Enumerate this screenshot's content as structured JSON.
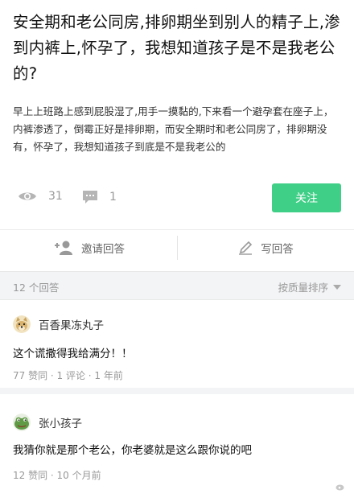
{
  "question": {
    "title": "安全期和老公同房,排卵期坐到别人的精子上,渗到内裤上,怀孕了，我想知道孩子是不是我老公的?",
    "body": "早上上班路上感到屁股湿了,用手一摸黏的,下来看一个避孕套在座子上，内裤渗透了，倒霉正好是排卵期，而安全期时和老公同房了，排卵期没有，怀孕了，我想知道孩子到底是不是我老公的"
  },
  "stats": {
    "views": "31",
    "comments": "1",
    "view_icon": "eye-icon",
    "comment_icon": "comment-icon"
  },
  "follow_button": "关注",
  "actions": {
    "invite_label": "邀请回答",
    "invite_icon": "add-user-icon",
    "write_label": "写回答",
    "write_icon": "pencil-icon"
  },
  "answers_header": {
    "count": "12 个回答",
    "sort": "按质量排序",
    "sort_icon": "chevron-down-icon"
  },
  "answers": [
    {
      "author": "百香果冻丸子",
      "avatar_icon": "avatar-doge",
      "text": "这个谎撒得我给满分！！",
      "meta": "77 赞同 · 1 评论 · 1 年前"
    },
    {
      "author": "张小孩子",
      "avatar_icon": "avatar-frog",
      "text": "我猜你就是那个老公，你老婆就是这么跟你说的吧",
      "meta": "12 赞同 · 10 个月前"
    }
  ],
  "colors": {
    "accent": "#3fcf86",
    "muted": "#999999",
    "divider": "#f3f4f6"
  }
}
